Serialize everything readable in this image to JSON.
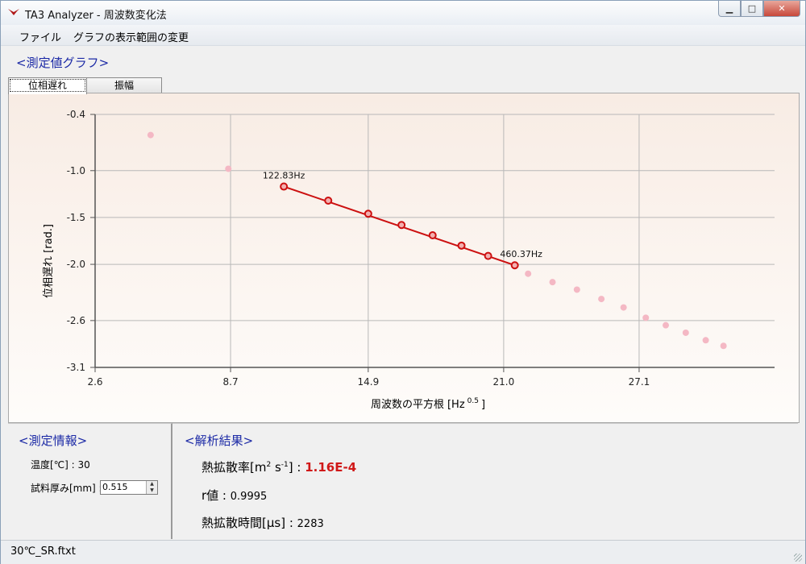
{
  "window": {
    "title": "TA3 Analyzer - 周波数変化法"
  },
  "menu": {
    "file": "ファイル",
    "graph_range": "グラフの表示範囲の変更"
  },
  "graph_section": {
    "title": "<測定値グラフ>"
  },
  "tabs": [
    {
      "label": "位相遅れ",
      "active": true
    },
    {
      "label": "振幅",
      "active": false
    }
  ],
  "chart_data": {
    "type": "scatter",
    "xlabel": "周波数の平方根",
    "xlabel_unit_base": "[Hz",
    "xlabel_unit_sup": "0.5",
    "xlabel_unit_end": "]",
    "ylabel": "位相遅れ [rad.]",
    "x_ticks": [
      "2.6",
      "8.7",
      "14.9",
      "21.0",
      "27.1"
    ],
    "y_ticks": [
      "-0.4",
      "-1.0",
      "-1.5",
      "-2.0",
      "-2.6",
      "-3.1"
    ],
    "xlim": [
      2.6,
      33.2
    ],
    "ylim": [
      -3.1,
      -0.4
    ],
    "grid": true,
    "series": [
      {
        "role": "excluded",
        "color": "#f4b8c4",
        "points": [
          [
            5.1,
            -0.62
          ],
          [
            8.6,
            -0.98
          ],
          [
            22.1,
            -2.1
          ],
          [
            23.2,
            -2.19
          ],
          [
            24.3,
            -2.27
          ],
          [
            25.4,
            -2.37
          ],
          [
            26.4,
            -2.46
          ],
          [
            27.4,
            -2.57
          ],
          [
            28.3,
            -2.65
          ],
          [
            29.2,
            -2.73
          ],
          [
            30.1,
            -2.81
          ],
          [
            30.9,
            -2.87
          ]
        ]
      },
      {
        "role": "fit",
        "color": "#cc1010",
        "points": [
          [
            11.1,
            -1.17
          ],
          [
            13.1,
            -1.32
          ],
          [
            14.9,
            -1.46
          ],
          [
            16.4,
            -1.58
          ],
          [
            17.8,
            -1.69
          ],
          [
            19.1,
            -1.8
          ],
          [
            20.3,
            -1.91
          ],
          [
            21.5,
            -2.01
          ]
        ]
      }
    ],
    "annotations": [
      {
        "text": "122.83Hz",
        "x": 11.1,
        "y": -1.17
      },
      {
        "text": "460.37Hz",
        "x": 21.5,
        "y": -2.01
      }
    ]
  },
  "measurement_info": {
    "title": "<測定情報>",
    "temperature_label": "温度[℃] : ",
    "temperature_value": "30",
    "thickness_label": "試料厚み[mm] : ",
    "thickness_value": "0.515"
  },
  "analysis": {
    "title": "<解析結果>",
    "diffusivity_label_pre": "熱拡散率[m",
    "diffusivity_sup1": "2",
    "diffusivity_mid": " s",
    "diffusivity_sup2": "-1",
    "diffusivity_post": "] : ",
    "diffusivity_value": "1.16E-4",
    "r_label": "r値 : ",
    "r_value": "0.9995",
    "time_label": "熱拡散時間[μs] : ",
    "time_value": "2283"
  },
  "status": {
    "filename": "30℃_SR.ftxt"
  },
  "colors": {
    "title_blue": "#1c2aa6",
    "result_red": "#d01818",
    "fit_red": "#cc1010",
    "excluded_pink": "#f4b8c4"
  }
}
